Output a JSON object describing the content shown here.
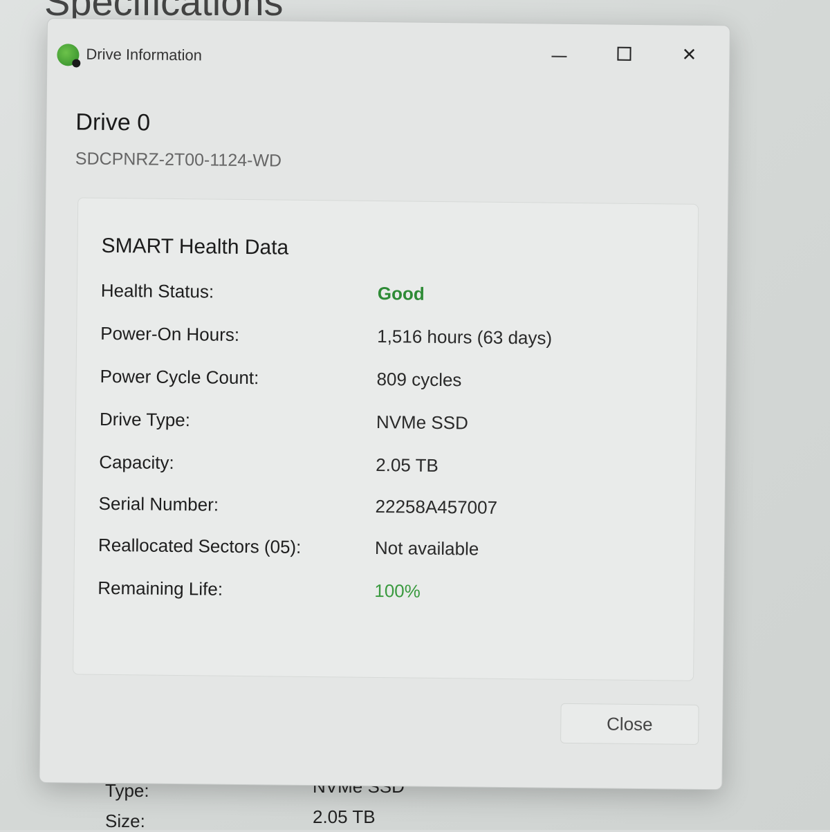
{
  "background": {
    "heading": "Specifications",
    "rows": [
      {
        "label": "Type:",
        "value": "NVMe SSD"
      },
      {
        "label": "Size:",
        "value": "2.05 TB"
      }
    ]
  },
  "window": {
    "title": "Drive Information",
    "icon": "drive-health-icon",
    "controls": {
      "minimize": "—",
      "maximize": "☐",
      "close": "✕"
    }
  },
  "drive": {
    "name": "Drive 0",
    "model": "SDCPNRZ-2T00-1124-WD"
  },
  "smart": {
    "title": "SMART Health Data",
    "fields": [
      {
        "label": "Health Status:",
        "value": "Good"
      },
      {
        "label": "Power-On Hours:",
        "value": "1,516 hours (63 days)"
      },
      {
        "label": "Power Cycle Count:",
        "value": "809 cycles"
      },
      {
        "label": "Drive Type:",
        "value": "NVMe SSD"
      },
      {
        "label": "Capacity:",
        "value": "2.05 TB"
      },
      {
        "label": "Serial Number:",
        "value": "22258A457007"
      },
      {
        "label": "Reallocated Sectors (05):",
        "value": "Not available"
      },
      {
        "label": "Remaining Life:",
        "value": "100%"
      }
    ]
  },
  "buttons": {
    "close_label": "Close"
  },
  "colors": {
    "good": "#2e8b36",
    "accent_green": "#3a9a3f",
    "window_bg": "#e4e6e5"
  }
}
